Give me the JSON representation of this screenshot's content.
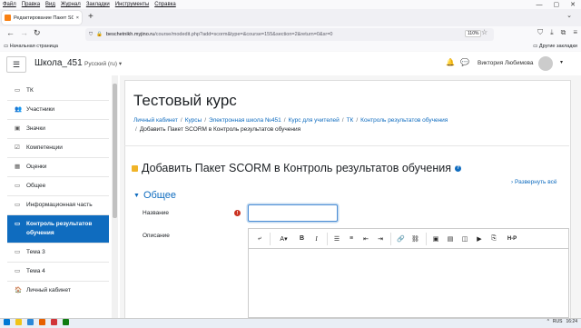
{
  "browser": {
    "menu": [
      "Файл",
      "Правка",
      "Вид",
      "Журнал",
      "Закладки",
      "Инструменты",
      "Справка"
    ],
    "window_controls": [
      "—",
      "▢",
      "✕"
    ],
    "tab_title": "Редактирование Пакет SCORM",
    "tab_close": "×",
    "new_tab": "+",
    "tab_menu": "⌄",
    "url_prefix": "beschetnikh.myjino.ru",
    "url_rest": "/course/modedit.php?add=scorm&type=&course=155&section=2&return=0&sr=0",
    "zoom": "110%",
    "bookmark_left": "Начальная страница",
    "bookmark_right": "Другие закладки"
  },
  "moodle": {
    "site_name": "Школа_451",
    "language": "Русский (ru)",
    "user_name": "Виктория Любимова"
  },
  "drawer": {
    "items": [
      {
        "label": "ТК",
        "icon": "▭",
        "active": false
      },
      {
        "label": "Участники",
        "icon": "👥",
        "active": false
      },
      {
        "label": "Значки",
        "icon": "▣",
        "active": false
      },
      {
        "label": "Компетенции",
        "icon": "☑",
        "active": false
      },
      {
        "label": "Оценки",
        "icon": "▦",
        "active": false
      },
      {
        "label": "Общее",
        "icon": "▭",
        "active": false
      },
      {
        "label": "Информационная часть",
        "icon": "▭",
        "active": false
      },
      {
        "label": "Контроль результатов обучения",
        "icon": "▭",
        "active": true
      },
      {
        "label": "Тема 3",
        "icon": "▭",
        "active": false
      },
      {
        "label": "Тема 4",
        "icon": "▭",
        "active": false
      },
      {
        "label": "Личный кабинет",
        "icon": "🏠",
        "active": false
      }
    ]
  },
  "main": {
    "course_title": "Тестовый курс",
    "breadcrumb": [
      "Личный кабинет",
      "Курсы",
      "Электронная школа №451",
      "Курс для учителей",
      "ТК",
      "Контроль результатов обучения",
      "Добавить Пакет SCORM в Контроль результатов обучения"
    ],
    "page_heading": "Добавить Пакет SCORM в Контроль результатов обучения",
    "expand_all": "Развернуть всё",
    "section_general": "Общее",
    "label_name": "Название",
    "label_description": "Описание",
    "name_value": ""
  },
  "editor_toolbar": [
    "⤶",
    "A▾",
    "B",
    "I",
    "☰",
    "≡",
    "⇤",
    "⇥",
    "🔗",
    "⛓",
    "▣",
    "▤",
    "◫",
    "▶",
    "⎘",
    "H-P"
  ],
  "taskbar": {
    "clock": "16:24",
    "lang": "RUS"
  },
  "colors": {
    "brand_blue": "#0f6cbf",
    "error_red": "#ca3120"
  }
}
